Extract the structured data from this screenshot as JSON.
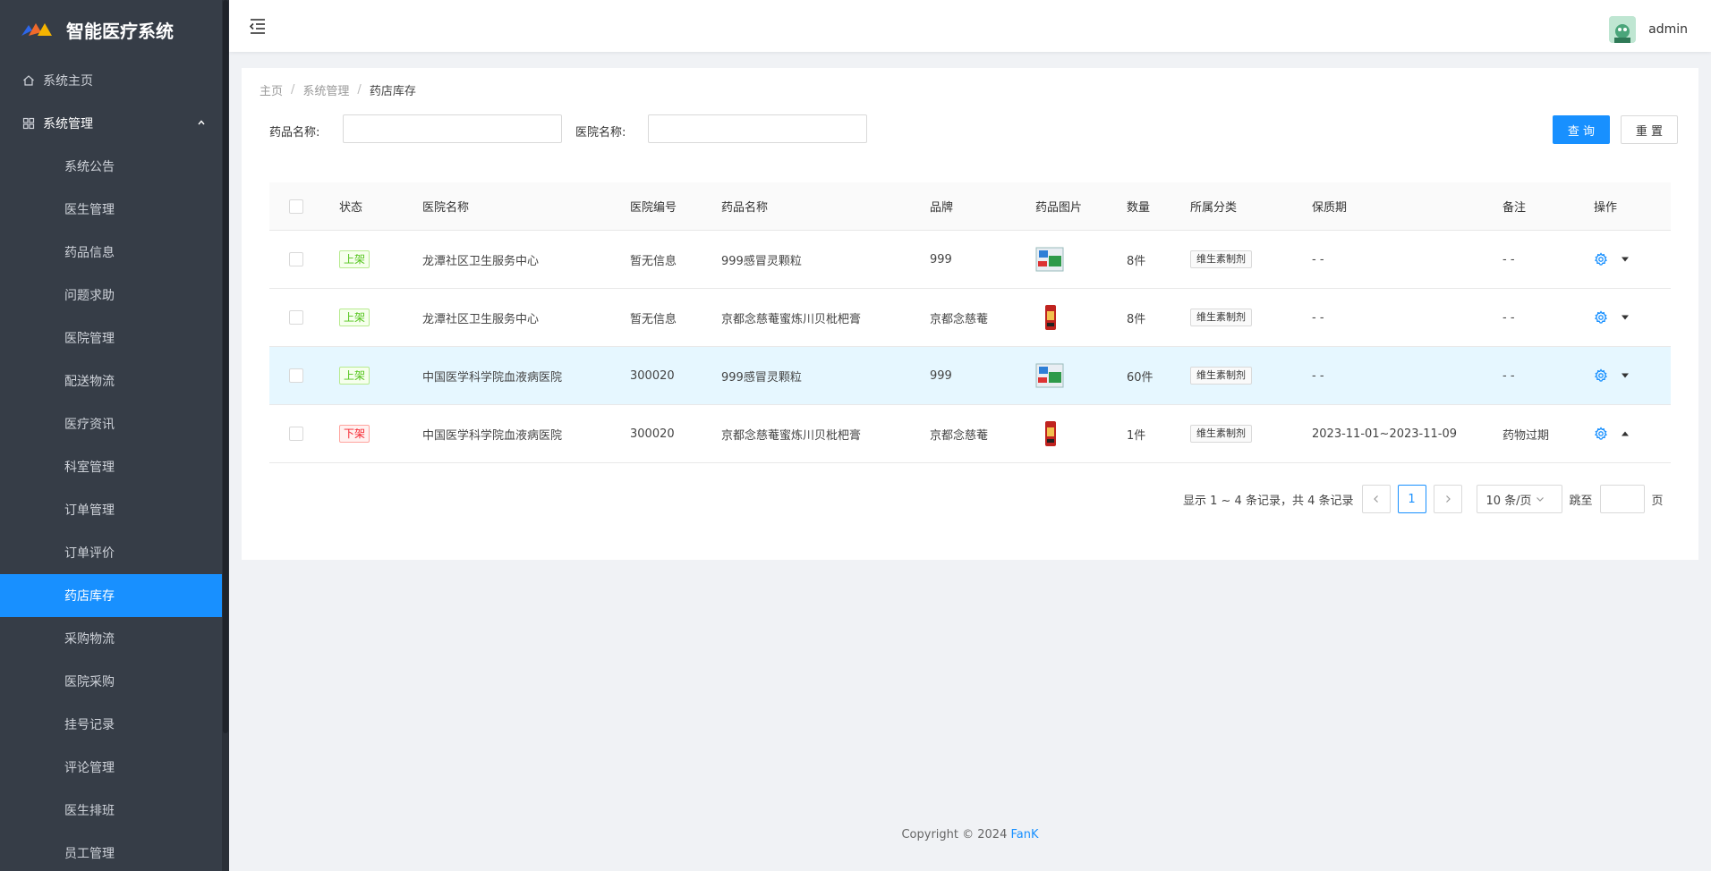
{
  "app": {
    "title": "智能医疗系统"
  },
  "sidebar": {
    "home": "系统主页",
    "group": "系统管理",
    "items": [
      "系统公告",
      "医生管理",
      "药品信息",
      "问题求助",
      "医院管理",
      "配送物流",
      "医疗资讯",
      "科室管理",
      "订单管理",
      "订单评价",
      "药店库存",
      "采购物流",
      "医院采购",
      "挂号记录",
      "评论管理",
      "医生排班",
      "员工管理"
    ],
    "active": "药店库存"
  },
  "header": {
    "username": "admin"
  },
  "breadcrumb": [
    "主页",
    "系统管理",
    "药店库存"
  ],
  "filters": {
    "drug_label": "药品名称:",
    "drug_value": "",
    "hospital_label": "医院名称:",
    "hospital_value": "",
    "search_button": "查 询",
    "reset_button": "重 置"
  },
  "table": {
    "columns": [
      "状态",
      "医院名称",
      "医院编号",
      "药品名称",
      "品牌",
      "药品图片",
      "数量",
      "所属分类",
      "保质期",
      "备注",
      "操作"
    ],
    "rows": [
      {
        "status": "上架",
        "status_type": "on",
        "hospital": "龙潭社区卫生服务中心",
        "hospital_no": "暂无信息",
        "drug": "999感冒灵颗粒",
        "brand": "999",
        "image": "box",
        "qty": "8件",
        "category": "维生素制剂",
        "expiry": "- -",
        "note": "- -",
        "expanded": false,
        "highlight": false
      },
      {
        "status": "上架",
        "status_type": "on",
        "hospital": "龙潭社区卫生服务中心",
        "hospital_no": "暂无信息",
        "drug": "京都念慈菴蜜炼川贝枇杷膏",
        "brand": "京都念慈菴",
        "image": "bottle",
        "qty": "8件",
        "category": "维生素制剂",
        "expiry": "- -",
        "note": "- -",
        "expanded": false,
        "highlight": false
      },
      {
        "status": "上架",
        "status_type": "on",
        "hospital": "中国医学科学院血液病医院",
        "hospital_no": "300020",
        "drug": "999感冒灵颗粒",
        "brand": "999",
        "image": "box",
        "qty": "60件",
        "category": "维生素制剂",
        "expiry": "- -",
        "note": "- -",
        "expanded": false,
        "highlight": true
      },
      {
        "status": "下架",
        "status_type": "off",
        "hospital": "中国医学科学院血液病医院",
        "hospital_no": "300020",
        "drug": "京都念慈菴蜜炼川贝枇杷膏",
        "brand": "京都念慈菴",
        "image": "bottle",
        "qty": "1件",
        "category": "维生素制剂",
        "expiry": "2023-11-01~2023-11-09",
        "note": "药物过期",
        "expanded": true,
        "highlight": false
      }
    ]
  },
  "pagination": {
    "summary": "显示 1 ~ 4 条记录，共 4 条记录",
    "current_page": "1",
    "page_size": "10 条/页",
    "jump_label": "跳至",
    "page_suffix": "页"
  },
  "footer": {
    "text": "Copyright © 2024 ",
    "author": "FanK"
  },
  "colors": {
    "primary": "#1890ff",
    "sidebar_bg": "#363d47",
    "on": "#52c41a",
    "off": "#f5222d"
  }
}
